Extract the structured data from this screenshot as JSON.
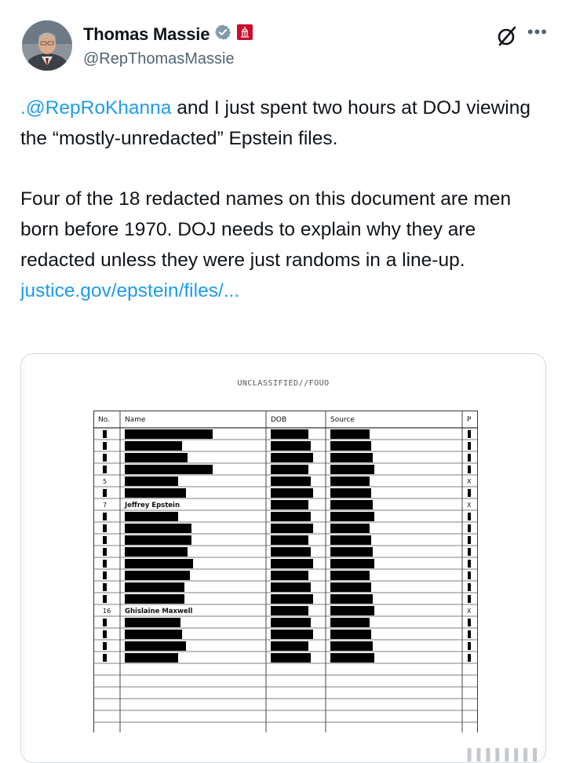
{
  "author": {
    "display_name": "Thomas Massie",
    "handle": "@RepThomasMassie"
  },
  "post": {
    "mention": ".@RepRoKhanna",
    "line1_rest": " and I just spent two hours at DOJ viewing the “mostly-unredacted” Epstein files.",
    "paragraph2": "Four of the 18 redacted names on this document are men born before 1970. DOJ needs to explain why they are redacted unless they were just randoms in a line-up.",
    "link": "justice.gov/epstein/files/..."
  },
  "document": {
    "classification": "UNCLASSIFIED//FOUO",
    "columns": [
      "No.",
      "Name",
      "DOB",
      "Source",
      "P"
    ],
    "rows": [
      {
        "no": "",
        "name": "",
        "name_redacted": 0.95,
        "x": false
      },
      {
        "no": "",
        "name": "",
        "name_redacted": 0.62,
        "x": false
      },
      {
        "no": "",
        "name": "",
        "name_redacted": 0.68,
        "x": false
      },
      {
        "no": "",
        "name": "",
        "name_redacted": 0.95,
        "x": false
      },
      {
        "no": "5",
        "name": "",
        "name_redacted": 0.58,
        "x": true
      },
      {
        "no": "",
        "name": "",
        "name_redacted": 0.66,
        "x": false
      },
      {
        "no": "7",
        "name": "Jeffrey Epstein",
        "name_redacted": 0,
        "x": true
      },
      {
        "no": "",
        "name": "",
        "name_redacted": 0.58,
        "x": false
      },
      {
        "no": "",
        "name": "",
        "name_redacted": 0.72,
        "x": false
      },
      {
        "no": "",
        "name": "",
        "name_redacted": 0.72,
        "x": false
      },
      {
        "no": "",
        "name": "",
        "name_redacted": 0.68,
        "x": false
      },
      {
        "no": "",
        "name": "",
        "name_redacted": 0.74,
        "x": false
      },
      {
        "no": "",
        "name": "",
        "name_redacted": 0.7,
        "x": false
      },
      {
        "no": "",
        "name": "",
        "name_redacted": 0.64,
        "x": false
      },
      {
        "no": "",
        "name": "",
        "name_redacted": 0.64,
        "x": false
      },
      {
        "no": "16",
        "name": "Ghislaine Maxwell",
        "name_redacted": 0,
        "x": true
      },
      {
        "no": "",
        "name": "",
        "name_redacted": 0.6,
        "x": false
      },
      {
        "no": "",
        "name": "",
        "name_redacted": 0.62,
        "x": false
      },
      {
        "no": "",
        "name": "",
        "name_redacted": 0.66,
        "x": false
      },
      {
        "no": "",
        "name": "",
        "name_redacted": 0.58,
        "x": false
      }
    ],
    "empty_rows": 7
  },
  "colors": {
    "link": "#1d9bf0",
    "verified_badge": "#829aab",
    "affiliate_badge": "#c8102e"
  }
}
